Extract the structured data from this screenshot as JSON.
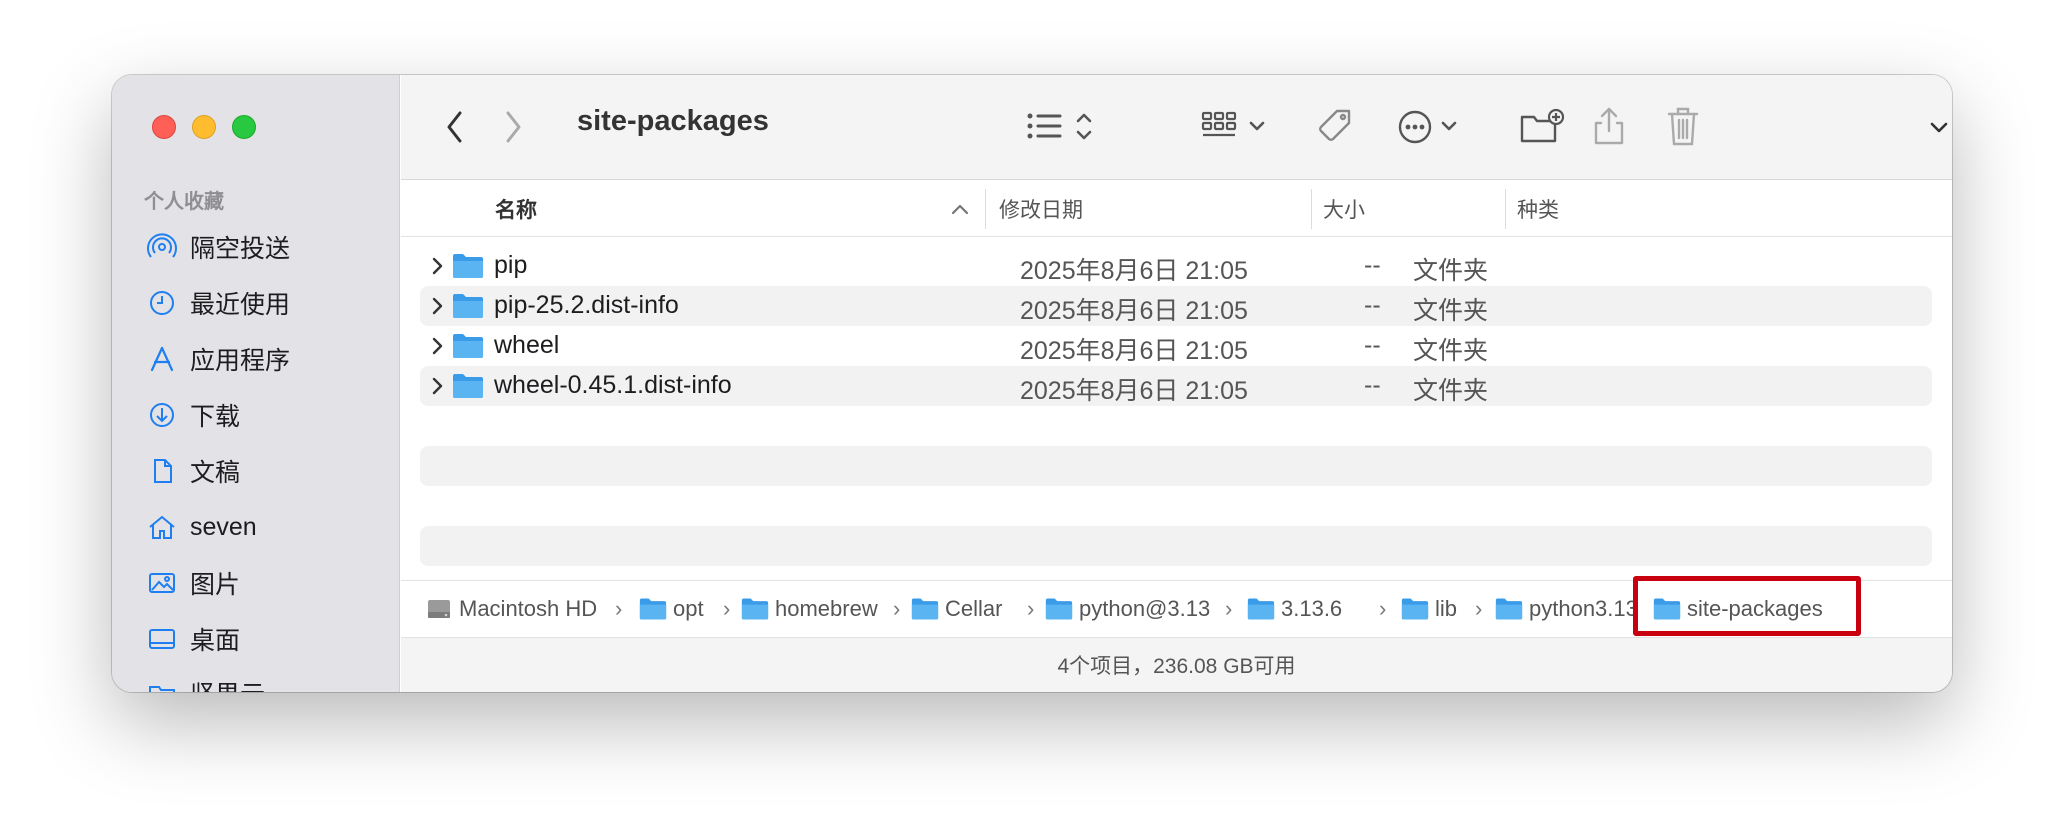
{
  "window": {
    "title": "site-packages"
  },
  "colors": {
    "accent": "#1f7ff0",
    "folder": "#5ab4f2",
    "highlight": "#c8000f"
  },
  "sidebar": {
    "section_title": "个人收藏",
    "items": [
      {
        "label": "隔空投送",
        "icon": "airdrop-icon"
      },
      {
        "label": "最近使用",
        "icon": "clock-icon"
      },
      {
        "label": "应用程序",
        "icon": "applications-icon"
      },
      {
        "label": "下载",
        "icon": "download-icon"
      },
      {
        "label": "文稿",
        "icon": "document-icon"
      },
      {
        "label": "seven",
        "icon": "home-icon"
      },
      {
        "label": "图片",
        "icon": "photo-icon"
      },
      {
        "label": "桌面",
        "icon": "desktop-icon"
      },
      {
        "label": "坚果云",
        "icon": "folder-icon"
      }
    ]
  },
  "columns": {
    "name": "名称",
    "date": "修改日期",
    "size": "大小",
    "kind": "种类"
  },
  "files": [
    {
      "name": "pip",
      "date": "2025年8月6日 21:05",
      "size": "--",
      "kind": "文件夹"
    },
    {
      "name": "pip-25.2.dist-info",
      "date": "2025年8月6日 21:05",
      "size": "--",
      "kind": "文件夹"
    },
    {
      "name": "wheel",
      "date": "2025年8月6日 21:05",
      "size": "--",
      "kind": "文件夹"
    },
    {
      "name": "wheel-0.45.1.dist-info",
      "date": "2025年8月6日 21:05",
      "size": "--",
      "kind": "文件夹"
    }
  ],
  "pathbar": {
    "crumbs": [
      "Macintosh HD",
      "opt",
      "homebrew",
      "Cellar",
      "python@3.13",
      "3.13.6",
      "lib",
      "python3.13",
      "site-packages"
    ]
  },
  "status": "4个项目，236.08 GB可用"
}
